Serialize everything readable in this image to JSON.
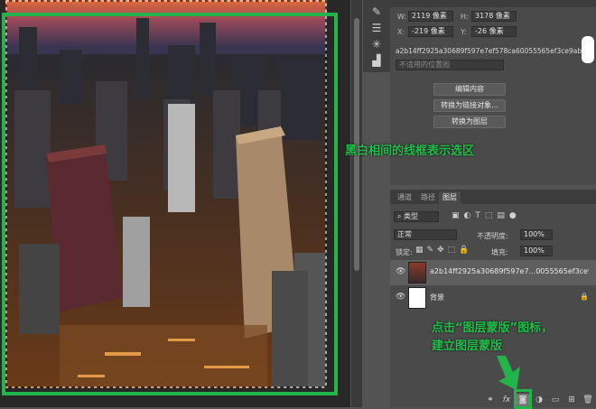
{
  "properties": {
    "w_label": "W:",
    "w_value": "2119 像素",
    "h_label": "H:",
    "h_value": "3178 像素",
    "x_label": "X:",
    "x_value": "-219 像素",
    "y_label": "Y:",
    "y_value": "-26 像素",
    "filename": "a2b14ff2925a30689f597e7ef578ca60055565ef3ce9ab-Nlghbi.jpg",
    "not_applied": "不适用的位置图",
    "btn_edit": "编辑内容",
    "btn_convert_link": "转换为链接对象...",
    "btn_convert_layer": "转换为图层"
  },
  "layers_panel": {
    "tabs": [
      "通道",
      "路径",
      "图层"
    ],
    "filter_kind": "类型",
    "blend_mode": "正常",
    "opacity_label": "不透明度:",
    "opacity_value": "100%",
    "lock_label": "锁定:",
    "fill_label": "填充:",
    "fill_value": "100%",
    "layers": [
      {
        "name": "a2b14ff2925a30689f597e7...0055565ef3ce9ab-Nlghbi"
      },
      {
        "name": "背景"
      }
    ]
  },
  "annotations": {
    "selection_note": "黑白相间的线框表示选区",
    "mask_note_line1": "点击“图层蒙版”图标，",
    "mask_note_line2": "建立图层蒙版"
  },
  "colors": {
    "annotation_green": "#22c04a",
    "panel_bg": "#4a4a4a"
  }
}
